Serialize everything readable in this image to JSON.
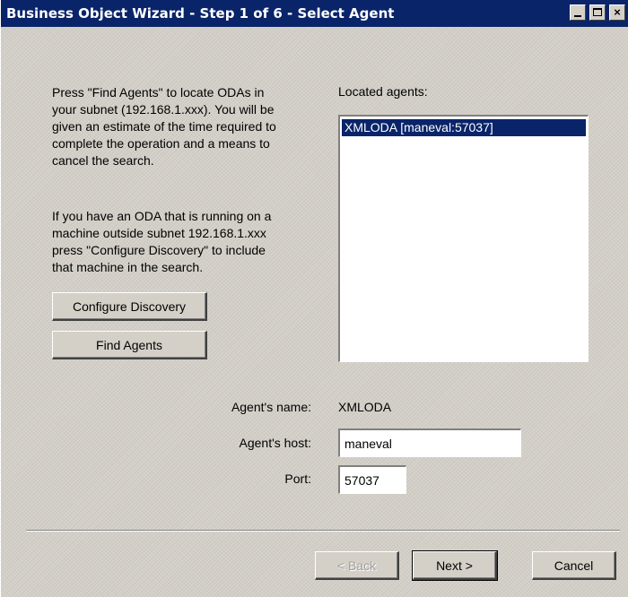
{
  "window": {
    "title": "Business Object Wizard - Step 1 of 6 - Select Agent",
    "controls": {
      "minimize_icon": "minimize-icon",
      "maximize_icon": "maximize-icon",
      "close_label": "×"
    }
  },
  "instructions": {
    "find_agents_text": "Press \"Find Agents\" to locate ODAs in your subnet (192.168.1.xxx). You will be given an estimate of the time required to complete the operation and a means to cancel the search.",
    "configure_text": "If you have an ODA that is running on a machine outside subnet 192.168.1.xxx press \"Configure Discovery\" to include that machine in the search."
  },
  "buttons": {
    "configure_discovery": "Configure Discovery",
    "find_agents": "Find Agents",
    "back": "< Back",
    "next": "Next >",
    "cancel": "Cancel"
  },
  "located_agents": {
    "label": "Located agents:",
    "items": [
      "XMLODA [maneval:57037]"
    ],
    "selected_index": 0
  },
  "agent_details": {
    "name_label": "Agent's name:",
    "name_value": "XMLODA",
    "host_label": "Agent's host:",
    "host_value": "maneval",
    "port_label": "Port:",
    "port_value": "57037"
  },
  "colors": {
    "titlebar": "#0a246a",
    "face": "#d4d0c8",
    "selection": "#0a246a"
  }
}
